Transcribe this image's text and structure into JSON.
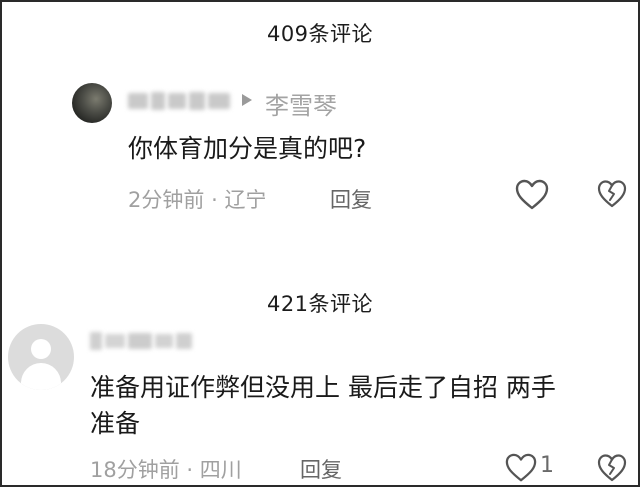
{
  "thread1": {
    "comment_count_label": "409条评论",
    "comment": {
      "avatar_icon": "dark-photo-avatar",
      "reply_to_name": "李雪琴",
      "text": "你体育加分是真的吧?",
      "time": "2分钟前",
      "separator": "·",
      "location": "辽宁",
      "reply_label": "回复",
      "like_icon": "heart-outline-icon",
      "dislike_icon": "broken-heart-icon"
    }
  },
  "thread2": {
    "comment_count_label": "421条评论",
    "comment": {
      "avatar_icon": "default-user-avatar",
      "text_line1": "准备用证作弊但没用上 最后走了自招  两手",
      "text_line2": "准备",
      "time": "18分钟前",
      "separator": "·",
      "location": "四川",
      "reply_label": "回复",
      "like_count": "1",
      "like_icon": "heart-outline-icon",
      "dislike_icon": "broken-heart-icon"
    }
  },
  "colors": {
    "text_primary": "#1a1a1a",
    "text_meta": "#a0a0a0",
    "icon": "#555555",
    "border": "#2a2a2a"
  }
}
